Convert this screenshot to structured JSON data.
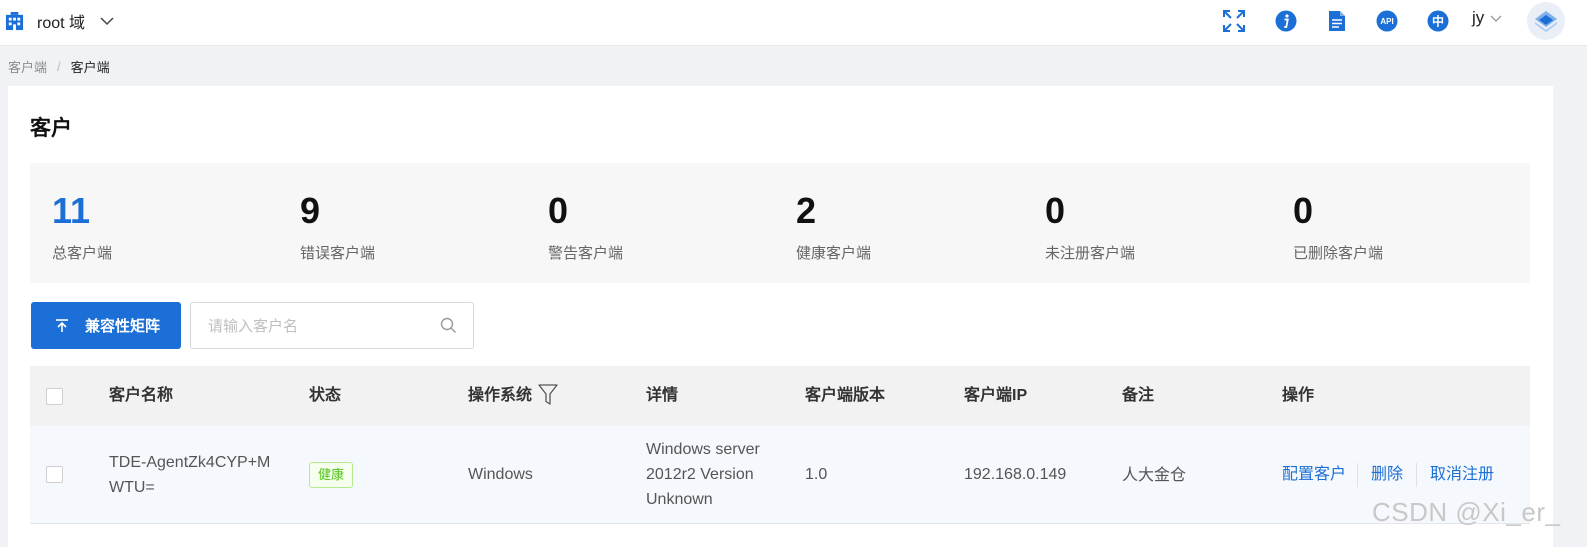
{
  "header": {
    "domain_label": "root 域",
    "tools": [
      "fullscreen-icon",
      "info-icon",
      "document-icon",
      "api-icon",
      "language-icon"
    ],
    "api_badge": "API",
    "lang_badge": "中",
    "user_name": "jy",
    "accent_color": "#1b6fd6"
  },
  "breadcrumb": {
    "parent": "客户端",
    "separator": "/",
    "current": "客户端"
  },
  "page": {
    "title": "客户"
  },
  "stats": [
    {
      "value": "11",
      "label": "总客户端"
    },
    {
      "value": "9",
      "label": "错误客户端"
    },
    {
      "value": "0",
      "label": "警告客户端"
    },
    {
      "value": "2",
      "label": "健康客户端"
    },
    {
      "value": "0",
      "label": "未注册客户端"
    },
    {
      "value": "0",
      "label": "已删除客户端"
    }
  ],
  "toolbar": {
    "matrix_button": "兼容性矩阵",
    "search_placeholder": "请输入客户名"
  },
  "table": {
    "columns": [
      "客户名称",
      "状态",
      "操作系统",
      "详情",
      "客户端版本",
      "客户端IP",
      "备注",
      "操作"
    ],
    "rows": [
      {
        "name_line1": "TDE-AgentZk4CYP+M",
        "name_line2": "WTU=",
        "status": "健康",
        "os": "Windows",
        "detail_line1": "Windows server",
        "detail_line2": "2012r2 Version",
        "detail_line3": "Unknown",
        "version": "1.0",
        "ip": "192.168.0.149",
        "remark": "人大金仓",
        "actions": [
          "配置客户",
          "删除",
          "取消注册"
        ]
      }
    ]
  },
  "watermark": "CSDN @Xi_er_"
}
